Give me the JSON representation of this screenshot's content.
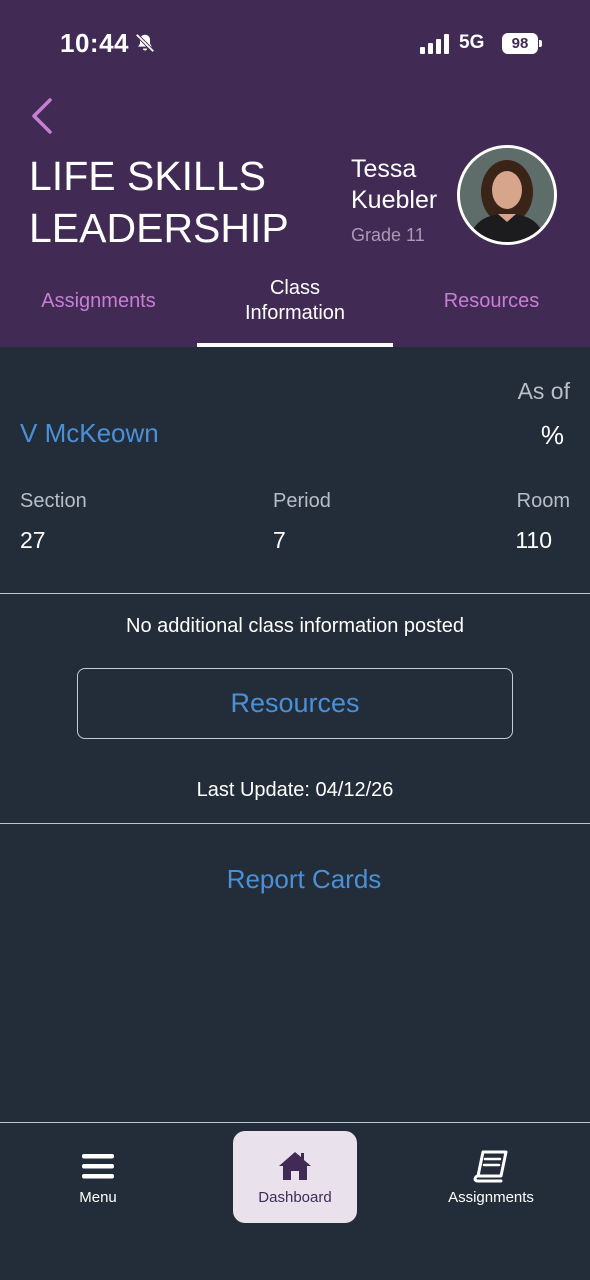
{
  "status_bar": {
    "time": "10:44",
    "network": "5G",
    "battery": "98"
  },
  "header": {
    "class_title_line1": "LIFE SKILLS",
    "class_title_line2": "LEADERSHIP",
    "student_first": "Tessa",
    "student_last": "Kuebler",
    "grade": "Grade 11",
    "colors": {
      "header_bg": "#412b55",
      "tab_inactive": "#c67fd3"
    }
  },
  "tabs": [
    {
      "label": "Assignments"
    },
    {
      "label": "Class Information",
      "active": true
    },
    {
      "label": "Resources"
    }
  ],
  "class_info": {
    "as_of": "As of",
    "teacher": "V McKeown",
    "percent": "%",
    "section_label": "Section",
    "section_value": "27",
    "period_label": "Period",
    "period_value": "7",
    "room_label": "Room",
    "room_value": "110",
    "no_info": "No additional class information posted",
    "resources_button": "Resources",
    "last_update": "Last Update: 04/12/26",
    "report_cards": "Report Cards",
    "colors": {
      "link": "#4a90d9",
      "background": "#232d39"
    }
  },
  "bottom_nav": {
    "menu": "Menu",
    "dashboard": "Dashboard",
    "assignments": "Assignments",
    "icons": [
      "hamburger-icon",
      "home-icon",
      "book-icon"
    ]
  }
}
